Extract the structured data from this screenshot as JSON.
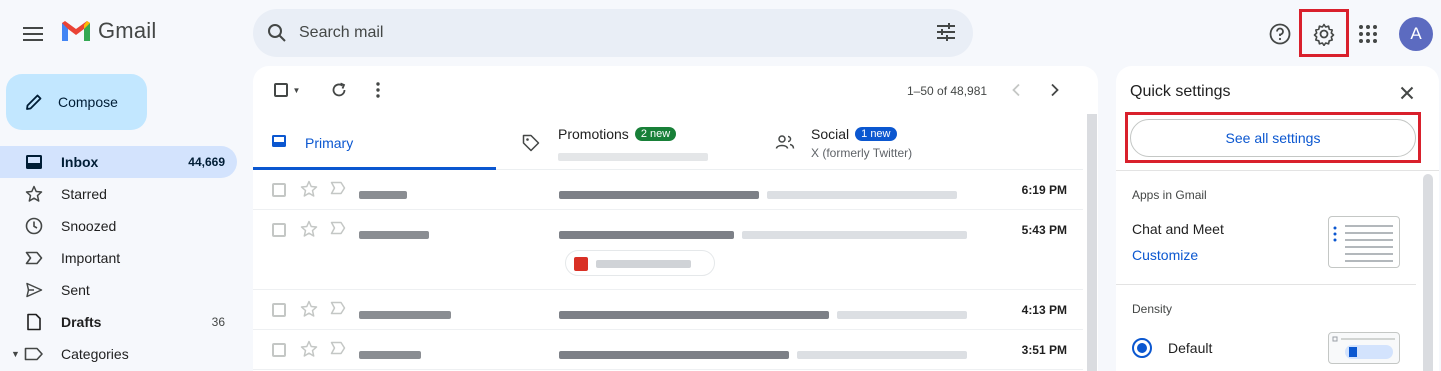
{
  "header": {
    "logo_text": "Gmail",
    "search_placeholder": "Search mail",
    "avatar_initial": "A"
  },
  "sidebar": {
    "compose_label": "Compose",
    "items": [
      {
        "label": "Inbox",
        "count": "44,669",
        "icon": "inbox-icon"
      },
      {
        "label": "Starred",
        "count": "",
        "icon": "star-icon"
      },
      {
        "label": "Snoozed",
        "count": "",
        "icon": "clock-icon"
      },
      {
        "label": "Important",
        "count": "",
        "icon": "important-icon"
      },
      {
        "label": "Sent",
        "count": "",
        "icon": "send-icon"
      },
      {
        "label": "Drafts",
        "count": "36",
        "icon": "draft-icon"
      },
      {
        "label": "Categories",
        "count": "",
        "icon": "label-icon"
      }
    ]
  },
  "toolbar": {
    "range_text": "1–50 of 48,981"
  },
  "tabs": [
    {
      "label": "Primary",
      "badge": "",
      "subtitle": ""
    },
    {
      "label": "Promotions",
      "badge": "2 new",
      "subtitle": ""
    },
    {
      "label": "Social",
      "badge": "1 new",
      "subtitle": "X (formerly Twitter)"
    }
  ],
  "emails": [
    {
      "time": "6:19 PM"
    },
    {
      "time": "5:43 PM"
    },
    {
      "time": "4:13 PM"
    },
    {
      "time": "3:51 PM"
    }
  ],
  "quick_settings": {
    "title": "Quick settings",
    "see_all_label": "See all settings",
    "apps_title": "Apps in Gmail",
    "apps_text": "Chat and Meet",
    "customize_label": "Customize",
    "density_title": "Density",
    "density_option": "Default"
  },
  "colors": {
    "accent": "#0b57d0",
    "highlight_box": "#d9202c",
    "compose_bg": "#c2e7ff",
    "active_nav_bg": "#d3e3fd"
  }
}
